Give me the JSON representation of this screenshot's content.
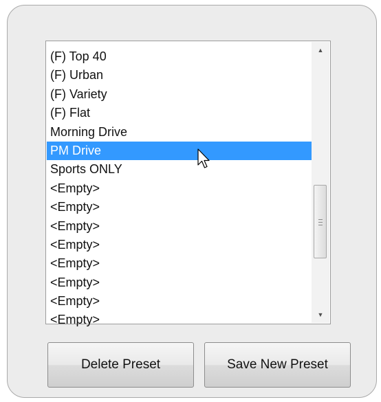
{
  "presets": {
    "items": [
      "(F) Top 40",
      "(F) Urban",
      "(F) Variety",
      "(F) Flat",
      "Morning Drive",
      "PM Drive",
      "Sports ONLY",
      "<Empty>",
      "<Empty>",
      "<Empty>",
      "<Empty>",
      "<Empty>",
      "<Empty>",
      "<Empty>",
      "<Empty>"
    ],
    "selected_index": 5,
    "selection_color": "#3399ff"
  },
  "buttons": {
    "delete_label": "Delete Preset",
    "save_label": "Save New Preset"
  },
  "icons": {
    "scroll_up": "scroll-up-arrow-icon",
    "scroll_down": "scroll-down-arrow-icon",
    "cursor": "mouse-pointer-cursor-icon"
  }
}
